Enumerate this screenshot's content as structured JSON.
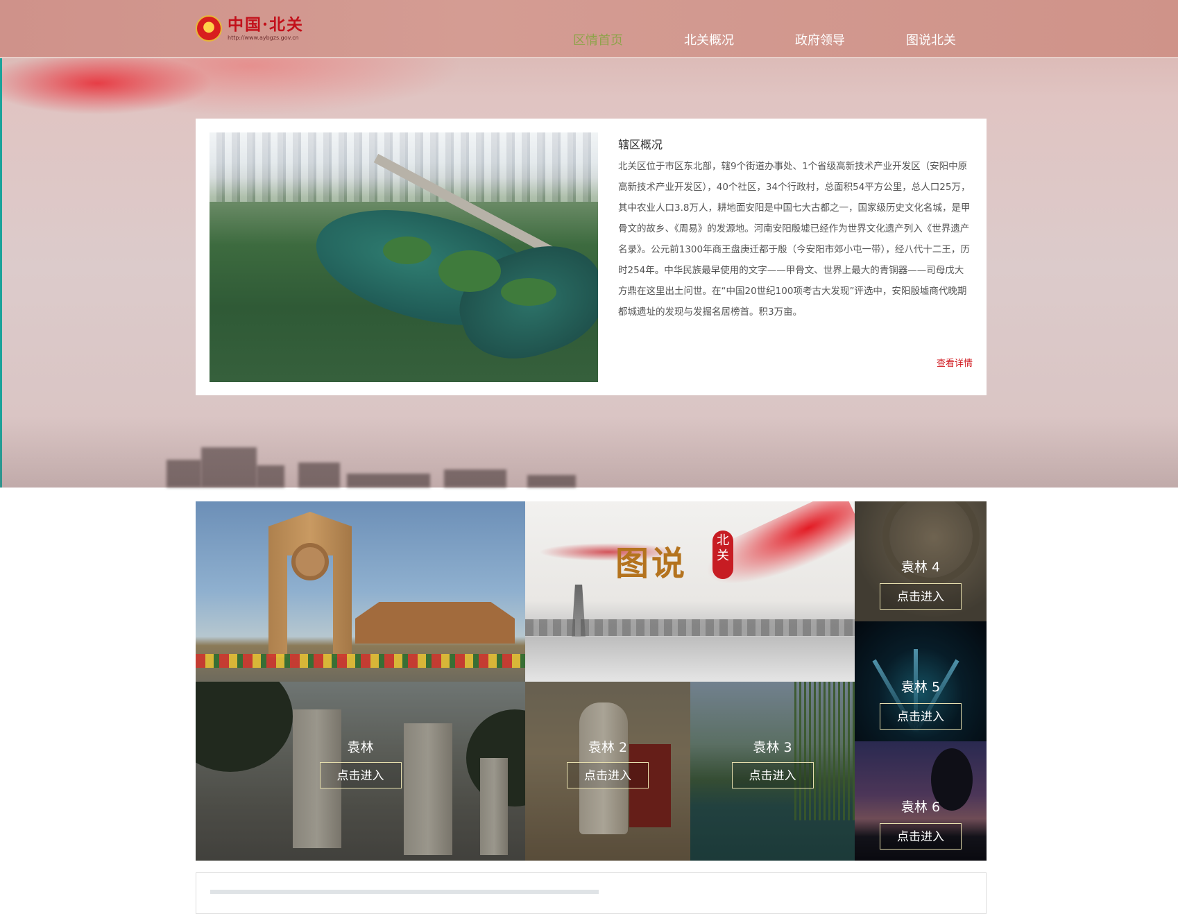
{
  "header": {
    "logo_title": "中国·北关",
    "logo_url": "http://www.aybgzs.gov.cn",
    "emblem_char": "★",
    "nav": [
      {
        "label": "区情首页",
        "active": true
      },
      {
        "label": "北关概况",
        "active": false
      },
      {
        "label": "政府领导",
        "active": false
      },
      {
        "label": "图说北关",
        "active": false
      }
    ]
  },
  "intro": {
    "title": "辖区概况",
    "body": "北关区位于市区东北部，辖9个街道办事处、1个省级高新技术产业开发区（安阳中原高新技术产业开发区），40个社区，34个行政村，总面积54平方公里，总人口25万，其中农业人口3.8万人，耕地面安阳是中国七大古都之一，国家级历史文化名城，是甲骨文的故乡、《周易》的发源地。河南安阳殷墟已经作为世界文化遗产列入《世界遗产名录》。公元前1300年商王盘庚迁都于殷（今安阳市郊小屯一带），经八代十二王，历时254年。中华民族最早使用的文字——甲骨文、世界上最大的青铜器——司母戊大方鼎在这里出土问世。在“中国20世纪100项考古大发现”评选中，安阳殷墟商代晚期都城遗址的发现与发掘名居榜首。积3万亩。",
    "more_label": "查看详情"
  },
  "banner": {
    "title_big": "图说",
    "seal": "北关"
  },
  "gallery": {
    "enter_label": "点击进入",
    "tiles": [
      {
        "label": "袁林"
      },
      {
        "label": "袁林 2"
      },
      {
        "label": "袁林 3"
      },
      {
        "label": "袁林 4"
      },
      {
        "label": "袁林 5"
      },
      {
        "label": "袁林 6"
      }
    ]
  }
}
